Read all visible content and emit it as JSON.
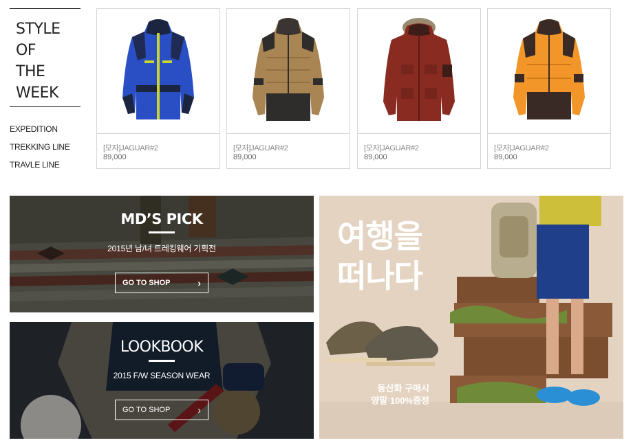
{
  "style_of_week": {
    "title_lines": [
      "STYLE",
      "OF",
      "THE",
      "WEEK"
    ],
    "links": [
      "EXPEDITION",
      "TREKKING LINE",
      "TRAVLE LINE"
    ]
  },
  "products": [
    {
      "name": "[모자]JAGUAR#2",
      "price": "89,000",
      "color": "blue-jacket"
    },
    {
      "name": "[모자]JAGUAR#2",
      "price": "89,000",
      "color": "khaki-jacket"
    },
    {
      "name": "[모자]JAGUAR#2",
      "price": "89,000",
      "color": "red-jacket"
    },
    {
      "name": "[모자]JAGUAR#2",
      "price": "89,000",
      "color": "orange-jacket"
    }
  ],
  "banners": {
    "md_pick": {
      "title": "MD’S PICK",
      "subtitle": "2015년 남/녀 트레킹웨어 기획전",
      "button": "GO TO SHOP"
    },
    "lookbook": {
      "title": "LOOKBOOK",
      "subtitle": "2015 F/W SEASON WEAR",
      "button": "GO TO SHOP"
    },
    "travel": {
      "title_line1": "여행을",
      "title_line2": "떠나다",
      "promo_line1": "등산화 구매시",
      "promo_line2": "양말 100%증정"
    }
  },
  "colors": {
    "card_border": "#d6d6d6",
    "text_dark": "#222222",
    "text_muted": "#888888"
  }
}
